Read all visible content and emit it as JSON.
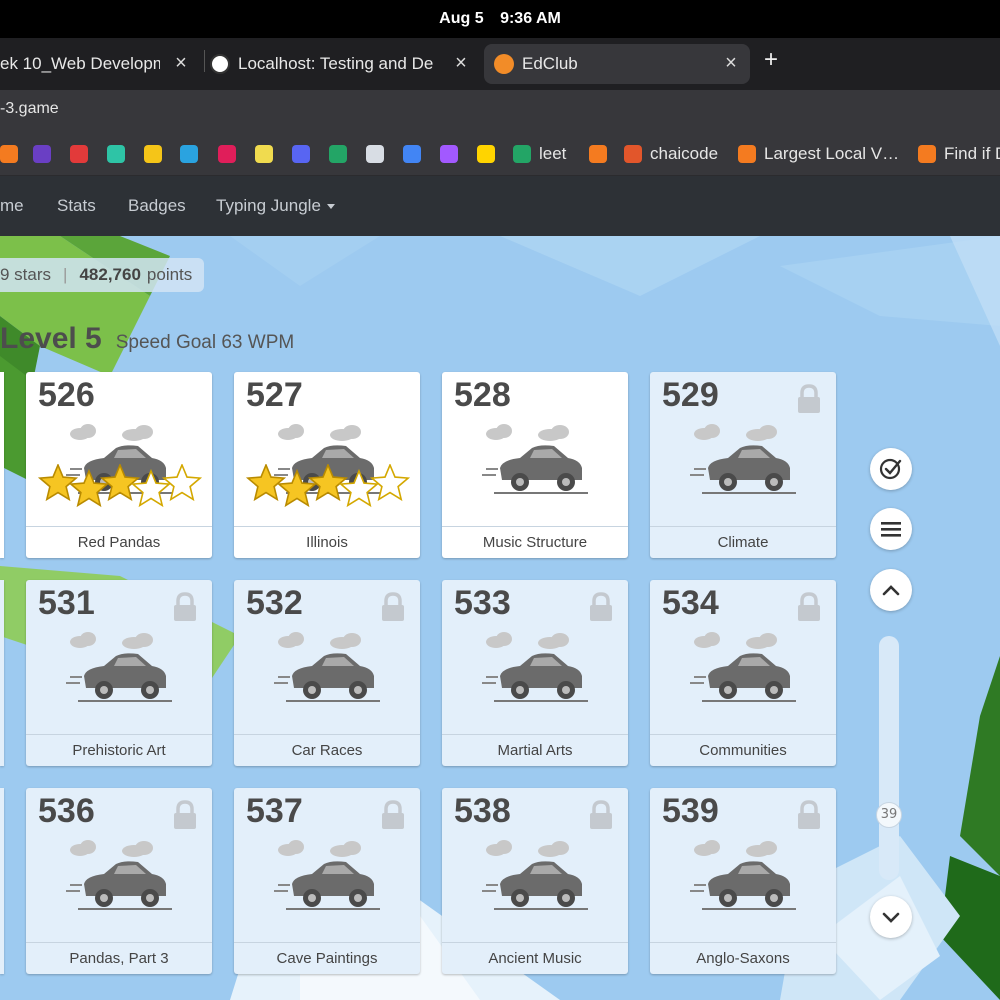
{
  "system": {
    "date": "Aug 5",
    "time": "9:36 AM"
  },
  "tabs": [
    {
      "title": "ek 10_Web Developm",
      "close": "×"
    },
    {
      "title": "Localhost: Testing and De",
      "close": "×"
    },
    {
      "title": "EdClub",
      "close": "×",
      "active": true
    }
  ],
  "new_tab": "+",
  "url": "-3.game",
  "bookmarks": [
    {
      "label": "",
      "color": "#f47b20"
    },
    {
      "label": "",
      "color": "#6a3fc4"
    },
    {
      "label": "",
      "color": "#e23a3a"
    },
    {
      "label": "",
      "color": "#2ec4a6"
    },
    {
      "label": "",
      "color": "#f5c518"
    },
    {
      "label": "",
      "color": "#2aa3e0"
    },
    {
      "label": "",
      "color": "#e01e5a"
    },
    {
      "label": "",
      "color": "#f0db4f"
    },
    {
      "label": "",
      "color": "#5865f2"
    },
    {
      "label": "",
      "color": "#23a566"
    },
    {
      "label": "",
      "color": "#d8dde4"
    },
    {
      "label": "",
      "color": "#4285f4"
    },
    {
      "label": "",
      "color": "#a259ff"
    },
    {
      "label": "",
      "color": "#ffd400"
    },
    {
      "label": "leet",
      "color": "#23a566"
    },
    {
      "label": "",
      "color": "#f47b20"
    },
    {
      "label": "chaicode",
      "color": "#e2562b"
    },
    {
      "label": "Largest Local V…",
      "color": "#f47b20"
    },
    {
      "label": "Find if D",
      "color": "#f47b20"
    }
  ],
  "nav": {
    "items": [
      "me",
      "Stats",
      "Badges",
      "Typing Jungle"
    ]
  },
  "stats": {
    "stars": "9 stars",
    "points_value": "482,760",
    "points_label": "points"
  },
  "level": {
    "title": "Level 5",
    "goal": "Speed Goal 63 WPM"
  },
  "lessons": [
    {
      "num": "526",
      "title": "Red Pandas",
      "locked": false,
      "stars": 3,
      "max_stars": 5
    },
    {
      "num": "527",
      "title": "Illinois",
      "locked": false,
      "stars": 3,
      "max_stars": 5
    },
    {
      "num": "528",
      "title": "Music Structure",
      "locked": false,
      "stars": 0,
      "max_stars": 5
    },
    {
      "num": "529",
      "title": "Climate",
      "locked": true
    },
    {
      "num": "531",
      "title": "Prehistoric Art",
      "locked": true
    },
    {
      "num": "532",
      "title": "Car Races",
      "locked": true
    },
    {
      "num": "533",
      "title": "Martial Arts",
      "locked": true
    },
    {
      "num": "534",
      "title": "Communities",
      "locked": true
    },
    {
      "num": "536",
      "title": "Pandas, Part 3",
      "locked": true
    },
    {
      "num": "537",
      "title": "Cave Paintings",
      "locked": true
    },
    {
      "num": "538",
      "title": "Ancient Music",
      "locked": true
    },
    {
      "num": "539",
      "title": "Anglo-Saxons",
      "locked": true
    }
  ],
  "scroll": {
    "level_value": "39"
  }
}
